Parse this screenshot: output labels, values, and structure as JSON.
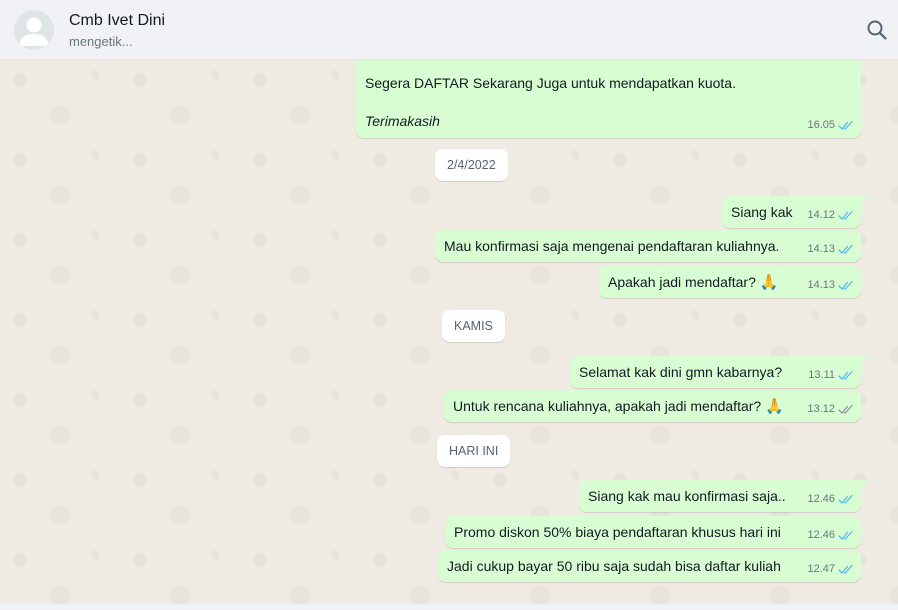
{
  "header": {
    "contact_name": "Cmb Ivet Dini",
    "status": "mengetik..."
  },
  "messages": [
    {
      "line1": "Segera DAFTAR Sekarang Juga untuk mendapatkan kuota.",
      "line2": "Terimakasih",
      "time": "16.05",
      "ticks": "read"
    },
    {
      "text": "Siang kak",
      "time": "14.12",
      "ticks": "read"
    },
    {
      "text": "Mau konfirmasi saja mengenai pendaftaran kuliahnya.",
      "time": "14.13",
      "ticks": "read"
    },
    {
      "text": "Apakah jadi mendaftar?",
      "emoji": "🙏",
      "time": "14.13",
      "ticks": "read"
    },
    {
      "text": "Selamat kak dini gmn kabarnya?",
      "time": "13.11",
      "ticks": "read"
    },
    {
      "text": "Untuk rencana kuliahnya, apakah jadi mendaftar?",
      "emoji": "🙏",
      "time": "13.12",
      "ticks": "delivered"
    },
    {
      "text": "Siang kak mau konfirmasi saja..",
      "time": "12.46",
      "ticks": "read"
    },
    {
      "text": "Promo diskon 50% biaya pendaftaran khusus hari ini",
      "time": "12.46",
      "ticks": "read"
    },
    {
      "text": "Jadi cukup bayar 50 ribu saja sudah bisa daftar kuliah",
      "time": "12.47",
      "ticks": "read"
    }
  ],
  "date_separators": [
    "2/4/2022",
    "KAMIS",
    "HARI INI"
  ],
  "colors": {
    "outgoing_bubble": "#d9fdd3",
    "read_tick": "#53bdeb",
    "delivered_tick": "#8696a0",
    "chat_background": "#efeae2"
  },
  "icons": {
    "search": "search-icon",
    "avatar": "default-avatar-icon"
  }
}
